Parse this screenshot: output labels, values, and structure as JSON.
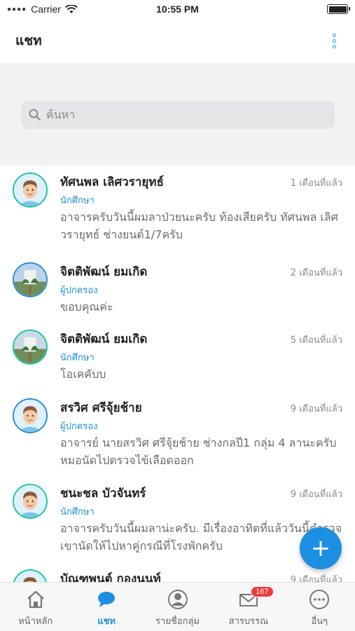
{
  "status_bar": {
    "carrier": "Carrier",
    "time": "10:55 PM"
  },
  "header": {
    "title": "แชท"
  },
  "search": {
    "placeholder": "ค้นหา"
  },
  "chats": [
    {
      "name": "ทัศนพล เลิศวรายุทธ์",
      "role": "นักศึกษา",
      "time": "1 เดือนที่แล้ว",
      "message": "อาจารครับวันนี้ผมลาป่วยนะครับ ท้องเสียครับ ทัศนพล เลิศวรายุทธ์ ช่างยนต์1/7ครับ"
    },
    {
      "name": "จิตติพัฒน์ ยมเกิด",
      "role": "ผู้ปกครอง",
      "time": "2 เดือนที่แล้ว",
      "message": "ขอบคุณค่ะ"
    },
    {
      "name": "จิตติพัฒน์ ยมเกิด",
      "role": "นักศึกษา",
      "time": "5 เดือนที่แล้ว",
      "message": "โอเคคับบ"
    },
    {
      "name": "สรวิศ ศรีจุ้ยช้าย",
      "role": "ผู้ปกครอง",
      "time": "9 เดือนที่แล้ว",
      "message": "อาจารย์ นายสรวิศ ศรีจุ้ยช้าย ช่างกลปี1 กลุ่ม 4 ลานะครับ หมอนัดไปตรวจไข้เลือดออก"
    },
    {
      "name": "ชนะชล บัวจันทร์",
      "role": "นักศึกษา",
      "time": "9 เดือนที่แล้ว",
      "message": "อาจารครับวันนี้ผมลาน่ะครับ. มีเรื่องอาทิตที่แล้ววันนี้ตำรวจเขานัดให้ไปหาคู่กรณีที่โรงพักครับ"
    },
    {
      "name": "บัณฑพนต์ กองนนท์",
      "role": "",
      "time": "9 เดือนที่แล้ว",
      "message": ""
    }
  ],
  "fab": {
    "icon": "plus-icon",
    "label": "+"
  },
  "tabs": [
    {
      "label": "หน้าหลัก",
      "icon": "home-icon"
    },
    {
      "label": "แชท",
      "icon": "chat-icon"
    },
    {
      "label": "รายชื่อกลุ่ม",
      "icon": "person-icon"
    },
    {
      "label": "สารบรรณ",
      "icon": "mail-icon",
      "badge": "167"
    },
    {
      "label": "อื่นๆ",
      "icon": "more-icon"
    }
  ],
  "colors": {
    "accent": "#1d8fe0",
    "badge": "#ef3b3b",
    "avatar_ring_student": "#1ec4a4",
    "avatar_ring_parent": "#2d8bd8"
  }
}
